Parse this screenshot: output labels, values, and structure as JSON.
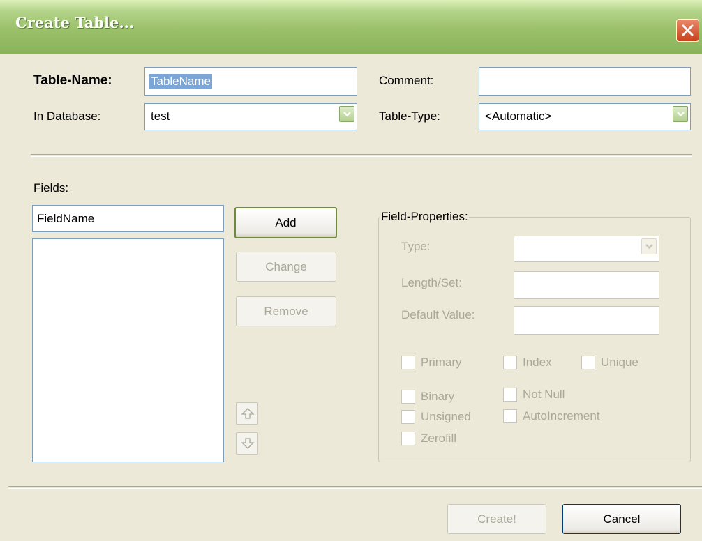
{
  "window": {
    "title": "Create Table..."
  },
  "table_name": {
    "label": "Table-Name:",
    "value": "TableName"
  },
  "comment": {
    "label": "Comment:",
    "value": ""
  },
  "database": {
    "label": "In Database:",
    "value": "test"
  },
  "table_type": {
    "label": "Table-Type:",
    "value": "<Automatic>"
  },
  "fields": {
    "label": "Fields:",
    "name_value": "FieldName",
    "add_label": "Add",
    "change_label": "Change",
    "remove_label": "Remove"
  },
  "properties": {
    "legend": "Field-Properties:",
    "type_label": "Type:",
    "type_value": "",
    "length_label": "Length/Set:",
    "length_value": "",
    "default_label": "Default Value:",
    "default_value": "",
    "primary_label": "Primary",
    "index_label": "Index",
    "unique_label": "Unique",
    "binary_label": "Binary",
    "notnull_label": "Not Null",
    "unsigned_label": "Unsigned",
    "autoinc_label": "AutoIncrement",
    "zerofill_label": "Zerofill"
  },
  "footer": {
    "create_label": "Create!",
    "cancel_label": "Cancel"
  },
  "colors": {
    "titlebar": "#9bc06a",
    "close": "#c8421b",
    "dialog": "#ece9d8",
    "disabled_text": "#aca899"
  }
}
